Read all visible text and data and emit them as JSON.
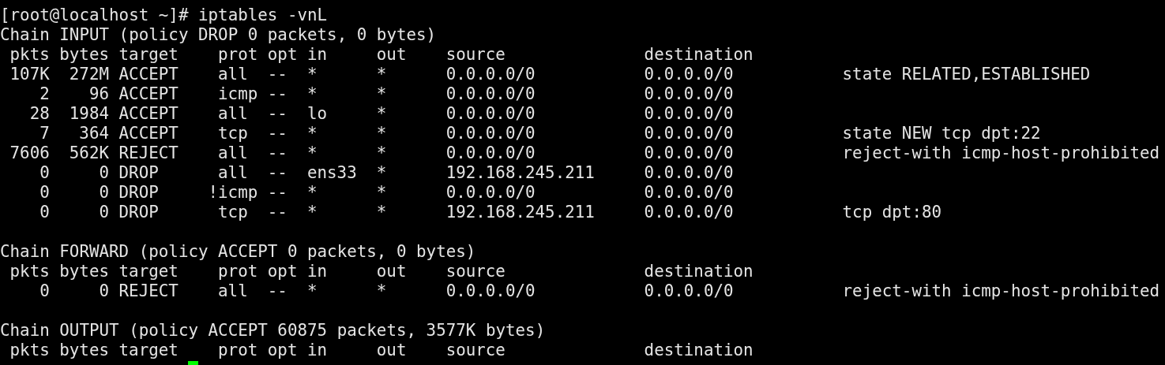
{
  "terminal": {
    "prompt_line": "[root@localhost ~]# iptables -vnL",
    "chains": [
      {
        "title": "Chain INPUT (policy DROP 0 packets, 0 bytes)",
        "columns": [
          "pkts",
          "bytes",
          "target",
          "prot",
          "opt",
          "in",
          "out",
          "source",
          "destination"
        ],
        "rows": [
          {
            "pkts": "107K",
            "bytes": "272M",
            "target": "ACCEPT",
            "prot": "all",
            "negated": false,
            "opt": "--",
            "in": "*",
            "out": "*",
            "source": "0.0.0.0/0",
            "destination": "0.0.0.0/0",
            "options": "state RELATED,ESTABLISHED"
          },
          {
            "pkts": "2",
            "bytes": "96",
            "target": "ACCEPT",
            "prot": "icmp",
            "negated": false,
            "opt": "--",
            "in": "*",
            "out": "*",
            "source": "0.0.0.0/0",
            "destination": "0.0.0.0/0"
          },
          {
            "pkts": "28",
            "bytes": "1984",
            "target": "ACCEPT",
            "prot": "all",
            "negated": false,
            "opt": "--",
            "in": "lo",
            "out": "*",
            "source": "0.0.0.0/0",
            "destination": "0.0.0.0/0"
          },
          {
            "pkts": "7",
            "bytes": "364",
            "target": "ACCEPT",
            "prot": "tcp",
            "negated": false,
            "opt": "--",
            "in": "*",
            "out": "*",
            "source": "0.0.0.0/0",
            "destination": "0.0.0.0/0",
            "options": "state NEW tcp dpt:22"
          },
          {
            "pkts": "7606",
            "bytes": "562K",
            "target": "REJECT",
            "prot": "all",
            "negated": false,
            "opt": "--",
            "in": "*",
            "out": "*",
            "source": "0.0.0.0/0",
            "destination": "0.0.0.0/0",
            "options": "reject-with icmp-host-prohibited"
          },
          {
            "pkts": "0",
            "bytes": "0",
            "target": "DROP",
            "prot": "all",
            "negated": false,
            "opt": "--",
            "in": "ens33",
            "out": "*",
            "source": "192.168.245.211",
            "destination": "0.0.0.0/0"
          },
          {
            "pkts": "0",
            "bytes": "0",
            "target": "DROP",
            "prot": "!icmp",
            "negated": true,
            "opt": "--",
            "in": "*",
            "out": "*",
            "source": "0.0.0.0/0",
            "destination": "0.0.0.0/0"
          },
          {
            "pkts": "0",
            "bytes": "0",
            "target": "DROP",
            "prot": "tcp",
            "negated": false,
            "opt": "--",
            "in": "*",
            "out": "*",
            "source": "192.168.245.211",
            "destination": "0.0.0.0/0",
            "options": "tcp dpt:80"
          }
        ]
      },
      {
        "title": "Chain FORWARD (policy ACCEPT 0 packets, 0 bytes)",
        "columns": [
          "pkts",
          "bytes",
          "target",
          "prot",
          "opt",
          "in",
          "out",
          "source",
          "destination"
        ],
        "rows": [
          {
            "pkts": "0",
            "bytes": "0",
            "target": "REJECT",
            "prot": "all",
            "negated": false,
            "opt": "--",
            "in": "*",
            "out": "*",
            "source": "0.0.0.0/0",
            "destination": "0.0.0.0/0",
            "options": "reject-with icmp-host-prohibited"
          }
        ]
      },
      {
        "title": "Chain OUTPUT (policy ACCEPT 60875 packets, 3577K bytes)",
        "columns": [
          "pkts",
          "bytes",
          "target",
          "prot",
          "opt",
          "in",
          "out",
          "source",
          "destination"
        ]
      }
    ]
  }
}
